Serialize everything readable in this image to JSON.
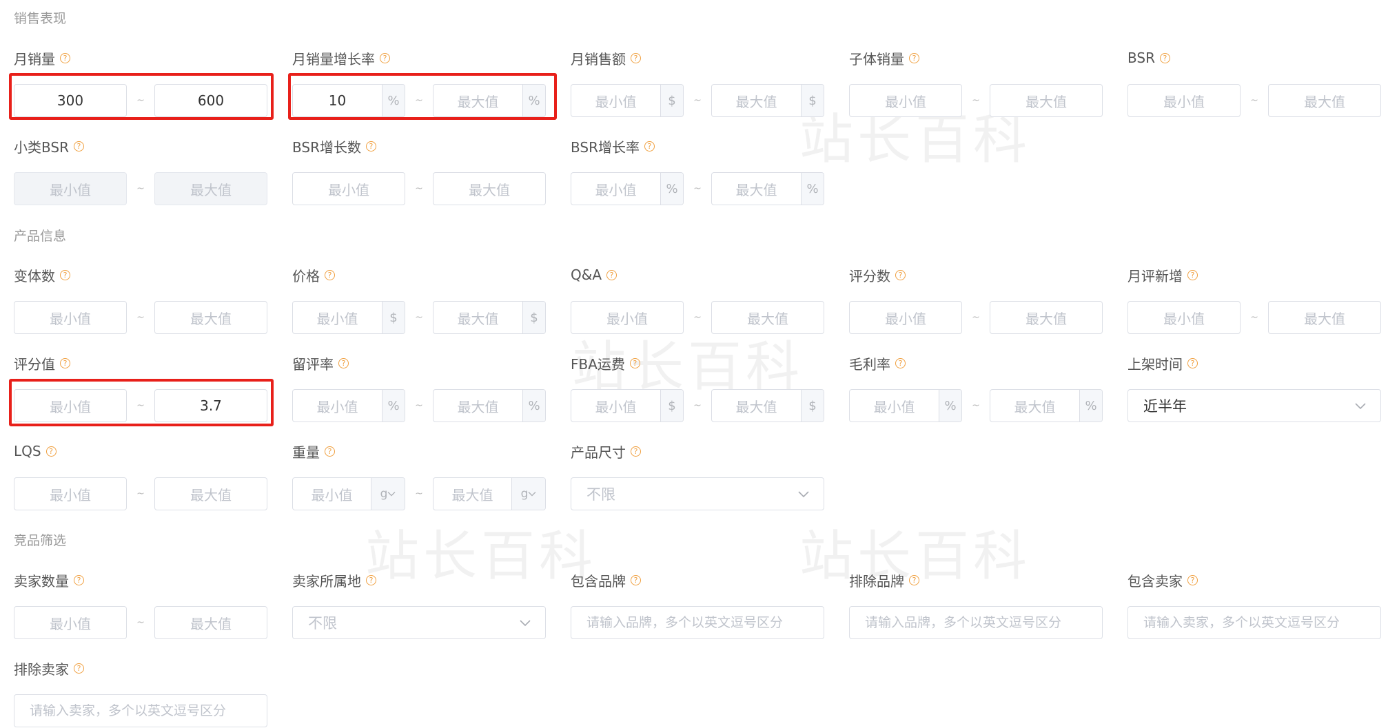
{
  "sections": {
    "sales": "销售表现",
    "product": "产品信息",
    "competitor": "竞品筛选"
  },
  "watermark": "站长百科",
  "common": {
    "min_placeholder": "最小值",
    "max_placeholder": "最大值",
    "range_separator": "~",
    "help_glyph": "?",
    "unit_percent": "%",
    "unit_dollar": "$",
    "unit_gram": "g"
  },
  "fields": {
    "monthly_sales": {
      "label": "月销量",
      "min": "300",
      "max": "600"
    },
    "monthly_sales_growth": {
      "label": "月销量增长率",
      "min": "10",
      "max": ""
    },
    "monthly_revenue": {
      "label": "月销售额",
      "min": "",
      "max": ""
    },
    "child_sales": {
      "label": "子体销量",
      "min": "",
      "max": ""
    },
    "bsr": {
      "label": "BSR",
      "min": "",
      "max": ""
    },
    "sub_bsr": {
      "label": "小类BSR",
      "min": "",
      "max": ""
    },
    "bsr_growth_count": {
      "label": "BSR增长数",
      "min": "",
      "max": ""
    },
    "bsr_growth_rate": {
      "label": "BSR增长率",
      "min": "",
      "max": ""
    },
    "variants": {
      "label": "变体数",
      "min": "",
      "max": ""
    },
    "price": {
      "label": "价格",
      "min": "",
      "max": ""
    },
    "qa": {
      "label": "Q&A",
      "min": "",
      "max": ""
    },
    "rating_count": {
      "label": "评分数",
      "min": "",
      "max": ""
    },
    "monthly_new_reviews": {
      "label": "月评新增",
      "min": "",
      "max": ""
    },
    "rating_value": {
      "label": "评分值",
      "min": "",
      "max": "3.7"
    },
    "review_rate": {
      "label": "留评率",
      "min": "",
      "max": ""
    },
    "fba_fee": {
      "label": "FBA运费",
      "min": "",
      "max": ""
    },
    "gross_margin": {
      "label": "毛利率",
      "min": "",
      "max": ""
    },
    "listing_time": {
      "label": "上架时间",
      "value": "近半年"
    },
    "lqs": {
      "label": "LQS",
      "min": "",
      "max": ""
    },
    "weight": {
      "label": "重量",
      "min": "",
      "max": ""
    },
    "product_size": {
      "label": "产品尺寸",
      "value": "不限"
    },
    "seller_count": {
      "label": "卖家数量",
      "min": "",
      "max": ""
    },
    "seller_location": {
      "label": "卖家所属地",
      "value": "不限"
    },
    "include_brand": {
      "label": "包含品牌",
      "placeholder": "请输入品牌，多个以英文逗号区分"
    },
    "exclude_brand": {
      "label": "排除品牌",
      "placeholder": "请输入品牌，多个以英文逗号区分"
    },
    "include_seller": {
      "label": "包含卖家",
      "placeholder": "请输入卖家，多个以英文逗号区分"
    },
    "exclude_seller": {
      "label": "排除卖家",
      "placeholder": "请输入卖家，多个以英文逗号区分"
    }
  },
  "colors": {
    "highlight": "#e8201a",
    "help_icon": "#f0a040",
    "border": "#dcdfe6",
    "placeholder": "#c0c4cc"
  }
}
